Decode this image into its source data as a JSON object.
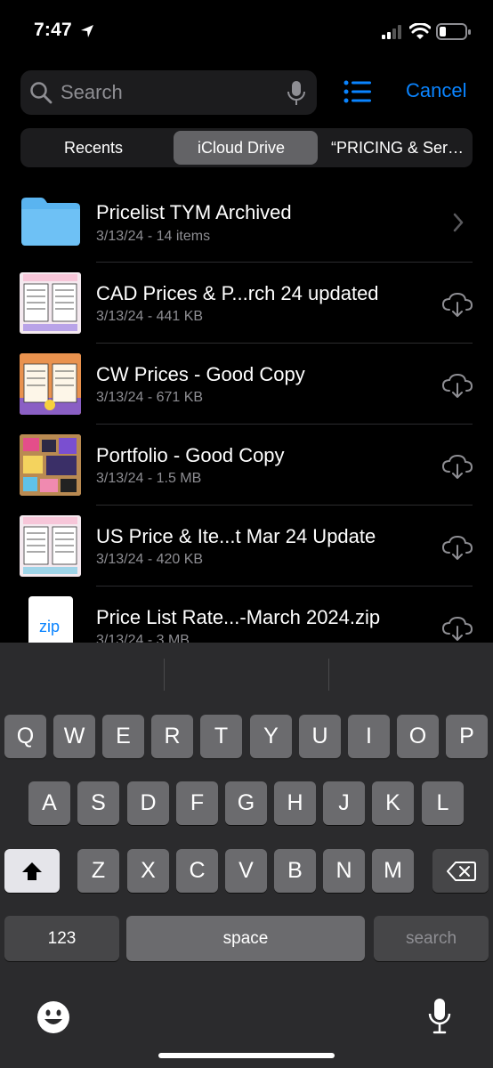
{
  "status": {
    "time": "7:47"
  },
  "search": {
    "placeholder": "Search",
    "cancel_label": "Cancel"
  },
  "segments": [
    {
      "label": "Recents"
    },
    {
      "label": "iCloud Drive"
    },
    {
      "label": "“PRICING & Ser…"
    }
  ],
  "files": [
    {
      "name": "Pricelist TYM Archived",
      "meta": "3/13/24 - 14 items",
      "kind": "folder"
    },
    {
      "name": "CAD Prices & P...rch 24 updated",
      "meta": "3/13/24 - 441 KB",
      "kind": "image"
    },
    {
      "name": "CW Prices - Good Copy",
      "meta": "3/13/24 - 671 KB",
      "kind": "image"
    },
    {
      "name": "Portfolio - Good Copy",
      "meta": "3/13/24 - 1.5 MB",
      "kind": "image"
    },
    {
      "name": "US Price & Ite...t Mar 24 Update",
      "meta": "3/13/24 - 420 KB",
      "kind": "image"
    },
    {
      "name": "Price List Rate...-March 2024.zip",
      "meta": "3/13/24 - 3 MB",
      "kind": "zip",
      "icon_text": "zip"
    }
  ],
  "keyboard": {
    "row1": [
      "Q",
      "W",
      "E",
      "R",
      "T",
      "Y",
      "U",
      "I",
      "O",
      "P"
    ],
    "row2": [
      "A",
      "S",
      "D",
      "F",
      "G",
      "H",
      "J",
      "K",
      "L"
    ],
    "row3": [
      "Z",
      "X",
      "C",
      "V",
      "B",
      "N",
      "M"
    ],
    "numbers_label": "123",
    "space_label": "space",
    "search_label": "search"
  },
  "colors": {
    "accent": "#0a84ff",
    "folder": "#5ab4f0"
  }
}
